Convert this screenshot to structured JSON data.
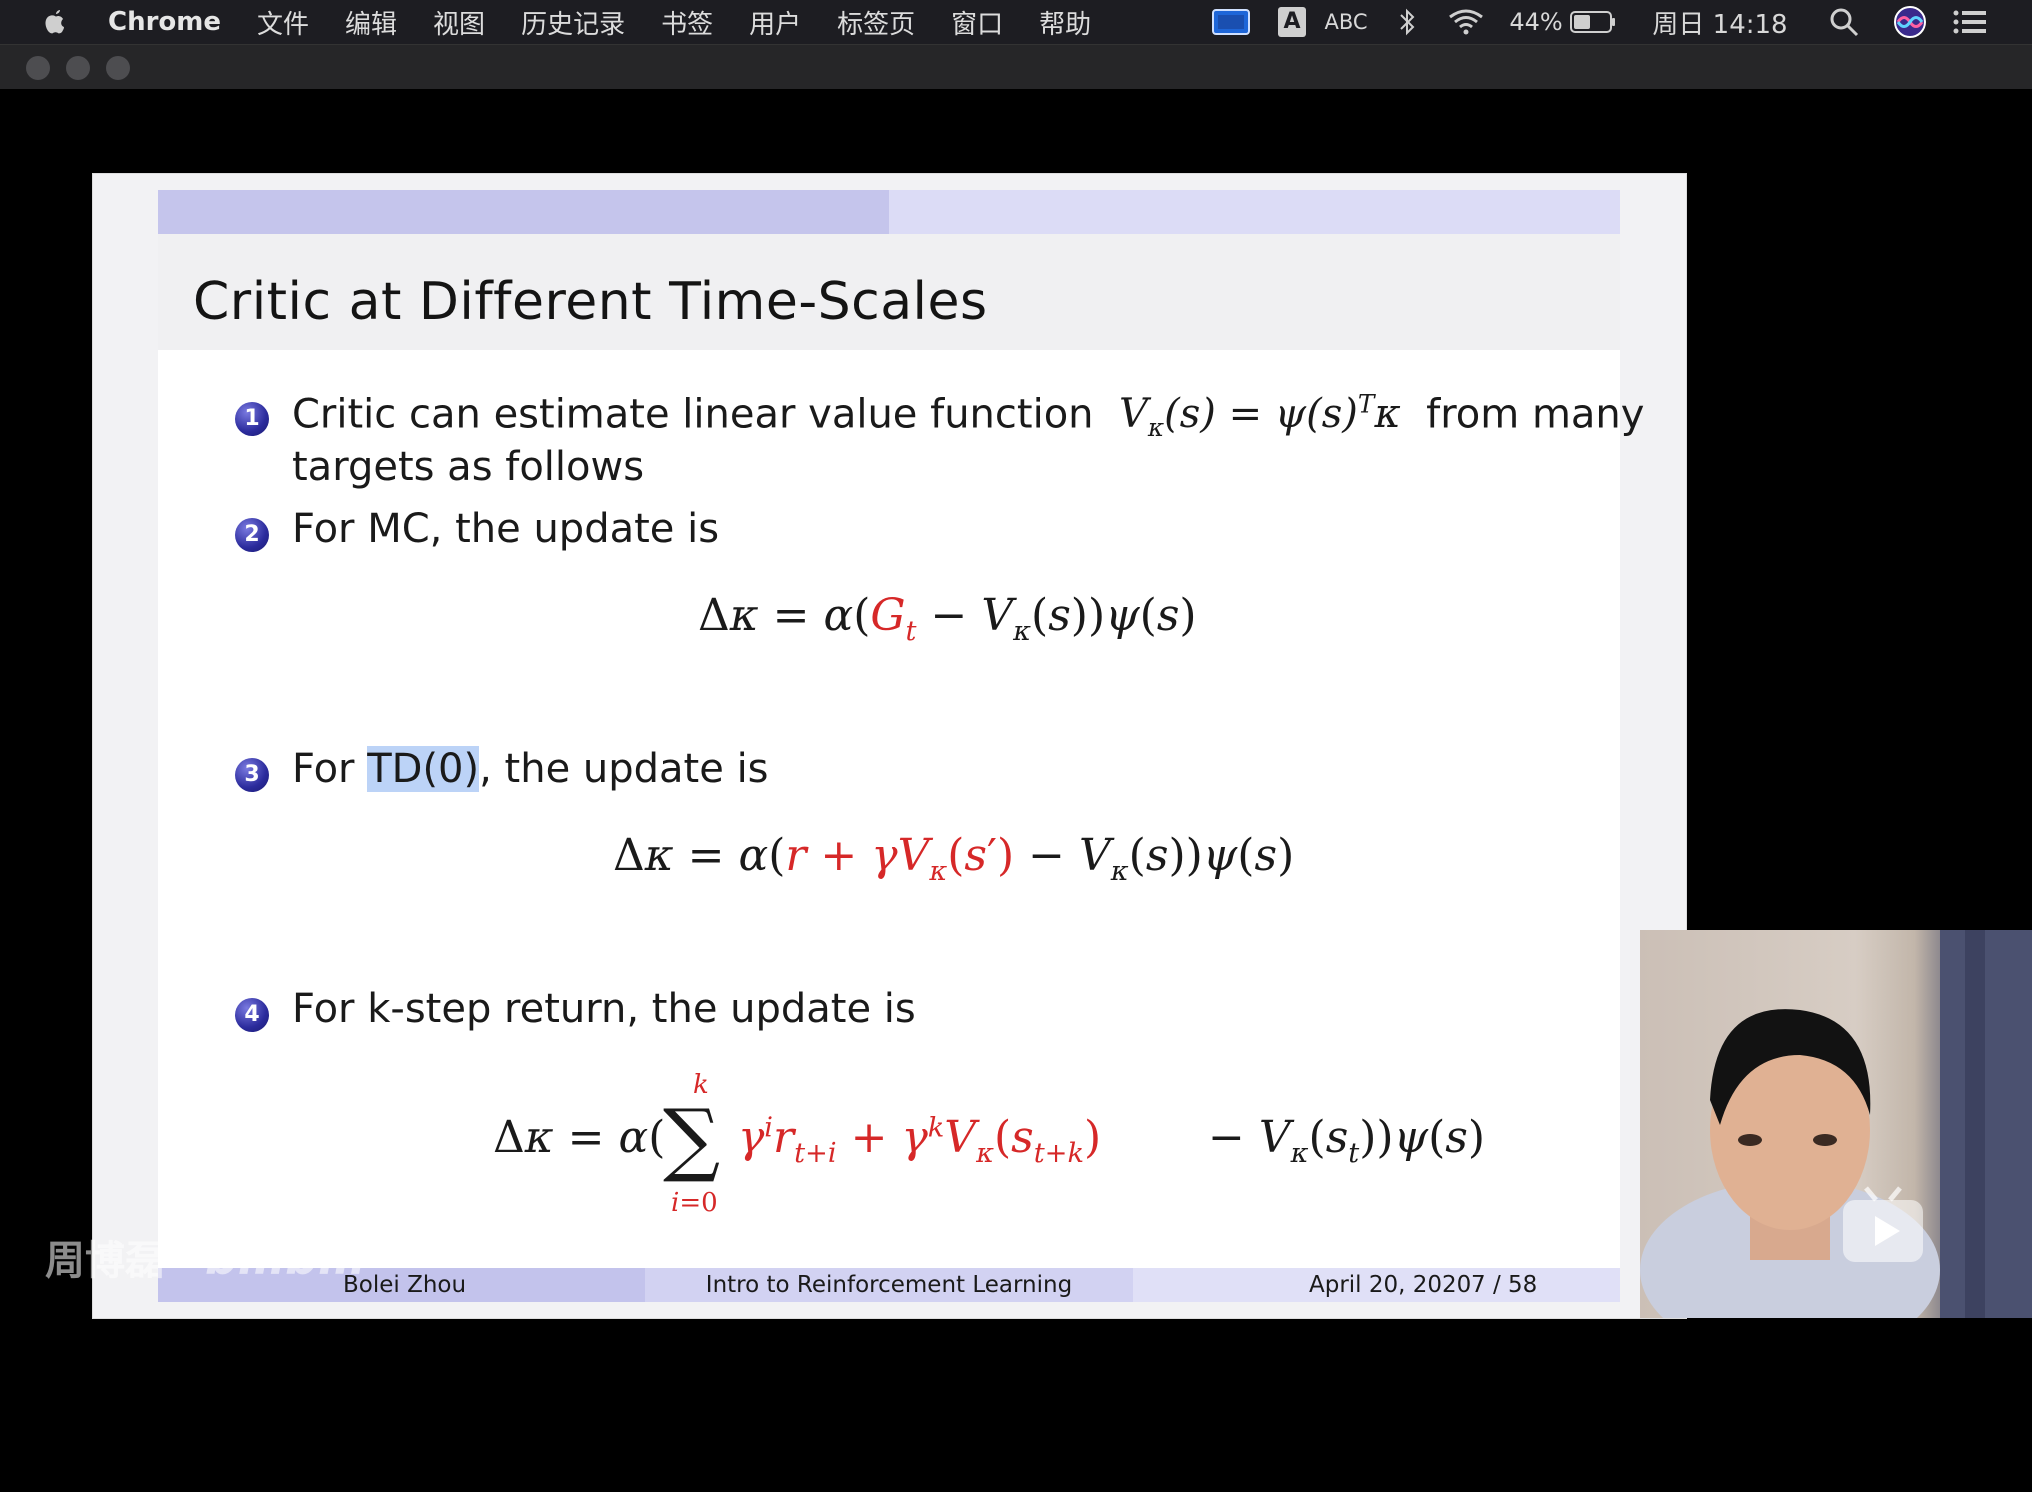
{
  "menubar": {
    "app_name": "Chrome",
    "items": [
      "文件",
      "编辑",
      "视图",
      "历史记录",
      "书签",
      "用户",
      "标签页",
      "窗口",
      "帮助"
    ],
    "input_source": "ABC",
    "input_badge": "A",
    "battery": "44%",
    "clock": "周日 14:18"
  },
  "slide": {
    "title": "Critic at Different Time-Scales",
    "items": [
      {
        "number": "1",
        "line1_prefix": "Critic can estimate linear value function",
        "line1_suffix": "from many",
        "line2": "targets as follows"
      },
      {
        "number": "2",
        "text": "For MC, the update is"
      },
      {
        "number": "3",
        "prefix": "For",
        "highlight": "TD(0)",
        "suffix": ", the update is"
      },
      {
        "number": "4",
        "text": "For k-step return, the update is"
      }
    ],
    "footer": {
      "author": "Bolei Zhou",
      "course": "Intro to Reinforcement Learning",
      "date": "April 20, 2020",
      "page": "7 / 58"
    }
  },
  "watermark": {
    "author": "周博磊",
    "brand": "bilibili"
  },
  "colors": {
    "accent_red": "#d62828",
    "beamer_blue": "#2b2b9c",
    "topbar": "#c5c5ec",
    "footer_band": "#c9c9ef"
  },
  "icons": [
    "apple-icon",
    "screen-mirror-icon",
    "bluetooth-icon",
    "wifi-icon",
    "battery-icon",
    "search-icon",
    "siri-icon",
    "notification-list-icon",
    "play-icon"
  ]
}
